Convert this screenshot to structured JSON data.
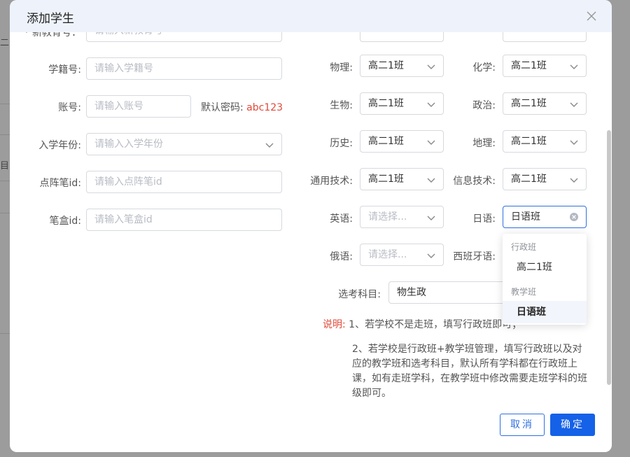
{
  "background": {
    "glimpse_1": "二",
    "glimpse_2": "目"
  },
  "modal": {
    "title": "添加学生",
    "close_icon": "close-icon"
  },
  "left_form": {
    "truncated_label": "* 新教育号：",
    "truncated_placeholder": "请输入新教育号",
    "student_no": {
      "label": "学籍号:",
      "placeholder": "请输入学籍号"
    },
    "account": {
      "label": "账号:",
      "placeholder": "请输入账号",
      "default_pwd_label": "默认密码:",
      "default_pwd": "abc123"
    },
    "enroll_year": {
      "label": "入学年份:",
      "placeholder": "请输入入学年份"
    },
    "pen_id": {
      "label": "点阵笔id:",
      "placeholder": "请输入点阵笔id"
    },
    "pen_box_id": {
      "label": "笔盒id:",
      "placeholder": "请输入笔盒id"
    }
  },
  "right_form": {
    "physics": {
      "label": "物理:",
      "value": "高二1班"
    },
    "chemistry": {
      "label": "化学:",
      "value": "高二1班"
    },
    "biology": {
      "label": "生物:",
      "value": "高二1班"
    },
    "politics": {
      "label": "政治:",
      "value": "高二1班"
    },
    "history": {
      "label": "历史:",
      "value": "高二1班"
    },
    "geography": {
      "label": "地理:",
      "value": "高二1班"
    },
    "general_tech": {
      "label": "通用技术:",
      "value": "高二1班"
    },
    "info_tech": {
      "label": "信息技术:",
      "value": "高二1班"
    },
    "english": {
      "label": "英语:",
      "placeholder": "请选择..."
    },
    "japanese": {
      "label": "日语:",
      "value": "日语班"
    },
    "russian": {
      "label": "俄语:",
      "placeholder": "请选择..."
    },
    "spanish": {
      "label": "西班牙语:"
    },
    "exam_subjects": {
      "label": "选考科目:",
      "value": "物生政"
    }
  },
  "notes": {
    "prefix": "说明:",
    "line1": "1、若学校不是走班，填写行政班即可；",
    "para2": [
      "2、若学校是行政班+教学班管理，填写行政班以及对",
      "应的教学班和选考科目，默认所有学科都在行政班上",
      "课，如有走班学科，在教学班中修改需要走班学科的班",
      "级即可。"
    ]
  },
  "dropdown": {
    "group1": "行政班",
    "item1": "高二1班",
    "group2": "教学班",
    "item2": "日语班"
  },
  "footer": {
    "cancel": "取消",
    "confirm": "确定"
  },
  "colors": {
    "primary": "#1561e8",
    "note_red": "#e04a3a",
    "header_bg": "#eef3fb"
  }
}
